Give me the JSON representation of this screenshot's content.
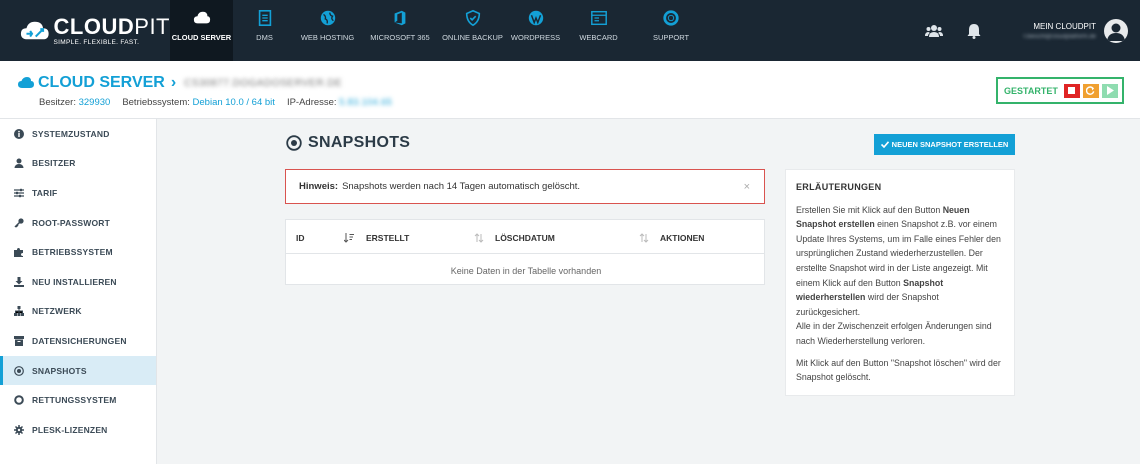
{
  "brand": {
    "name_bold": "CLOUD",
    "name_thin": "PIT",
    "tagline": "SIMPLE. FLEXIBLE. FAST."
  },
  "nav": {
    "items": [
      {
        "label": "CLOUD SERVER",
        "icon": "cloud-icon",
        "active": true
      },
      {
        "label": "DMS",
        "icon": "document-icon",
        "active": false
      },
      {
        "label": "WEB HOSTING",
        "icon": "globe-icon",
        "active": false
      },
      {
        "label": "MICROSOFT 365",
        "icon": "office-icon",
        "active": false
      },
      {
        "label": "ONLINE BACKUP",
        "icon": "shield-icon",
        "active": false
      },
      {
        "label": "WORDPRESS",
        "icon": "wordpress-icon",
        "active": false
      },
      {
        "label": "WEBCARD",
        "icon": "webcard-icon",
        "active": false
      },
      {
        "label": "SUPPORT",
        "icon": "lifebuoy-icon",
        "active": false
      }
    ],
    "account_title": "MEIN CLOUDPIT",
    "account_email": "f.beischl@cloudplatform.de"
  },
  "header": {
    "title": "CLOUD SERVER",
    "server_name": "CS30877.DOGADOSERVER.DE",
    "owner_label": "Besitzer:",
    "owner_value": "329930",
    "os_label": "Betriebssystem:",
    "os_value": "Debian 10.0 / 64 bit",
    "ip_label": "IP-Adresse:",
    "ip_value": "5.83.104.65",
    "status_label": "GESTARTET"
  },
  "sidebar": {
    "items": [
      {
        "label": "SYSTEMZUSTAND",
        "icon": "info-icon"
      },
      {
        "label": "BESITZER",
        "icon": "user-icon"
      },
      {
        "label": "TARIF",
        "icon": "sliders-icon"
      },
      {
        "label": "ROOT-PASSWORT",
        "icon": "key-icon"
      },
      {
        "label": "BETRIEBSSYSTEM",
        "icon": "puzzle-icon"
      },
      {
        "label": "NEU INSTALLIEREN",
        "icon": "download-icon"
      },
      {
        "label": "NETZWERK",
        "icon": "network-icon"
      },
      {
        "label": "DATENSICHERUNGEN",
        "icon": "archive-icon"
      },
      {
        "label": "SNAPSHOTS",
        "icon": "snapshot-icon",
        "active": true
      },
      {
        "label": "RETTUNGSSYSTEM",
        "icon": "lifebuoy-icon"
      },
      {
        "label": "PLESK-LIZENZEN",
        "icon": "gear-icon"
      }
    ]
  },
  "main": {
    "title": "SNAPSHOTS",
    "new_button": "NEUEN SNAPSHOT ERSTELLEN",
    "alert_label": "Hinweis:",
    "alert_text": "Snapshots werden nach 14 Tagen automatisch gelöscht.",
    "table": {
      "columns": [
        "ID",
        "ERSTELLT",
        "LÖSCHDATUM",
        "AKTIONEN"
      ],
      "empty_text": "Keine Daten in der Tabelle vorhanden"
    }
  },
  "help": {
    "title": "ERLÄUTERUNGEN",
    "p1_a": "Erstellen Sie mit Klick auf den Button ",
    "p1_b": "Neuen Snapshot erstellen",
    "p1_c": " einen Snapshot z.B. vor einem Update Ihres Systems, um im Falle eines Fehler den ursprünglichen Zustand wiederherzustellen. Der erstellte Snapshot wird in der Liste angezeigt. Mit einem Klick auf den Button ",
    "p1_d": "Snapshot wiederherstellen",
    "p1_e": " wird der Snapshot zurückgesichert.",
    "p2": "Alle in der Zwischenzeit erfolgen Änderungen sind nach Wiederherstellung verloren.",
    "p3": "Mit Klick auf den Button \"Snapshot löschen\" wird der Snapshot gelöscht."
  },
  "colors": {
    "accent": "#13a0d6",
    "topbar": "#1a2733",
    "success": "#34b36b",
    "danger": "#d9534f",
    "warning": "#f0a030"
  }
}
